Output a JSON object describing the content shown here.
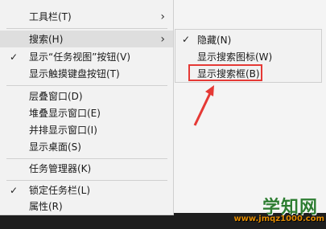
{
  "context_menu": {
    "items": [
      {
        "label": "工具栏(T)",
        "checked": false,
        "has_submenu": true
      },
      {
        "label": "搜索(H)",
        "checked": false,
        "has_submenu": true,
        "highlighted": true
      },
      {
        "label": "显示“任务视图”按钮(V)",
        "checked": true,
        "has_submenu": false
      },
      {
        "label": "显示触摸键盘按钮(T)",
        "checked": false,
        "has_submenu": false
      },
      {
        "label": "层叠窗口(D)",
        "checked": false,
        "has_submenu": false
      },
      {
        "label": "堆叠显示窗口(E)",
        "checked": false,
        "has_submenu": false
      },
      {
        "label": "并排显示窗口(I)",
        "checked": false,
        "has_submenu": false
      },
      {
        "label": "显示桌面(S)",
        "checked": false,
        "has_submenu": false
      },
      {
        "label": "任务管理器(K)",
        "checked": false,
        "has_submenu": false
      },
      {
        "label": "锁定任务栏(L)",
        "checked": true,
        "has_submenu": false
      },
      {
        "label": "属性(R)",
        "checked": false,
        "has_submenu": false
      }
    ],
    "check_glyph": "✓",
    "chevron_glyph": "›"
  },
  "search_submenu": {
    "items": [
      {
        "label": "隐藏(N)",
        "checked": true
      },
      {
        "label": "显示搜索图标(W)",
        "checked": false
      },
      {
        "label": "显示搜索框(B)",
        "checked": false,
        "annotated": true
      }
    ]
  },
  "annotation": {
    "color": "#e53935"
  },
  "watermark": {
    "title": "学知网",
    "url": "www.jmqz1000.com"
  },
  "colors": {
    "menu_bg": "#f2f2f2",
    "hover_bg": "#dedede",
    "taskbar": "#1e1e1e"
  }
}
